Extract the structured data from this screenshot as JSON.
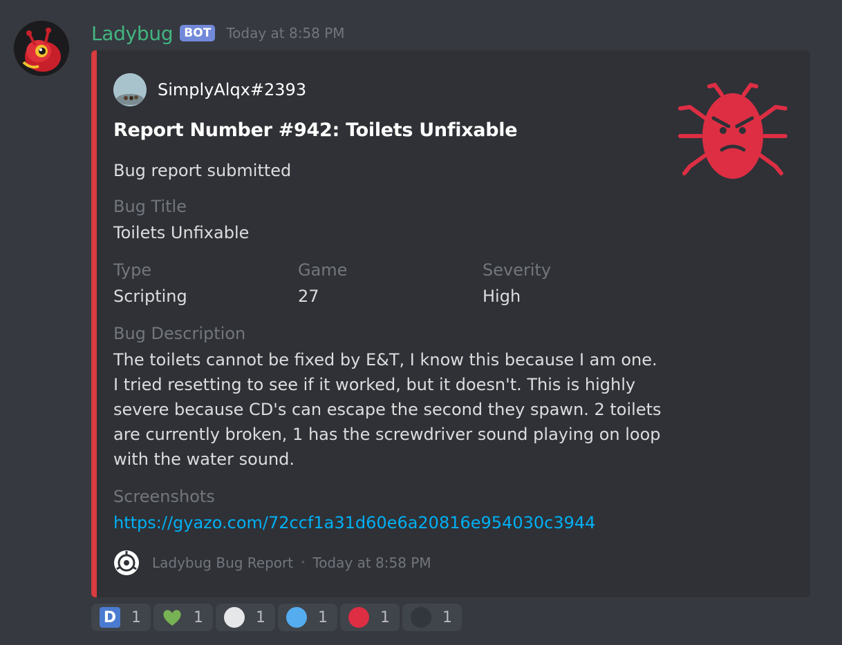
{
  "message": {
    "username": "Ladybug",
    "bot_tag": "BOT",
    "timestamp": "Today at 8:58 PM"
  },
  "embed": {
    "accent_color": "#d83c3e",
    "author": "SimplyAlqx#2393",
    "title": "Report Number #942: Toilets Unfixable",
    "description": "Bug report submitted",
    "fields": {
      "bug_title": {
        "name": "Bug Title",
        "value": "Toilets Unfixable"
      },
      "type": {
        "name": "Type",
        "value": "Scripting"
      },
      "game": {
        "name": "Game",
        "value": "27"
      },
      "severity": {
        "name": "Severity",
        "value": "High"
      },
      "bug_description": {
        "name": "Bug Description",
        "value": "The toilets cannot be fixed by E&T, I know this because I am one. I tried resetting to see if it worked, but it doesn't. This is highly severe because CD's can escape the second they spawn. 2 toilets are currently broken, 1 has the screwdriver sound playing on loop with the water sound."
      },
      "screenshots": {
        "name": "Screenshots",
        "value": "https://gyazo.com/72ccf1a31d60e6a20816e954030c3944"
      }
    },
    "footer": {
      "text": "Ladybug Bug Report",
      "separator": "•",
      "timestamp": "Today at 8:58 PM"
    },
    "thumbnail_icon": "angry-bug-icon"
  },
  "reactions": [
    {
      "emoji": "letter-d-icon",
      "glyph": "D",
      "count": "1",
      "color": "#4a7bd0"
    },
    {
      "emoji": "green-heart-icon",
      "count": "1",
      "color": "#77b255"
    },
    {
      "emoji": "white-circle-icon",
      "count": "1",
      "color": "#e6e7e8"
    },
    {
      "emoji": "blue-circle-icon",
      "count": "1",
      "color": "#55acee"
    },
    {
      "emoji": "red-circle-icon",
      "count": "1",
      "color": "#dd2e44"
    },
    {
      "emoji": "black-circle-icon",
      "count": "1",
      "color": "#31373d"
    }
  ]
}
